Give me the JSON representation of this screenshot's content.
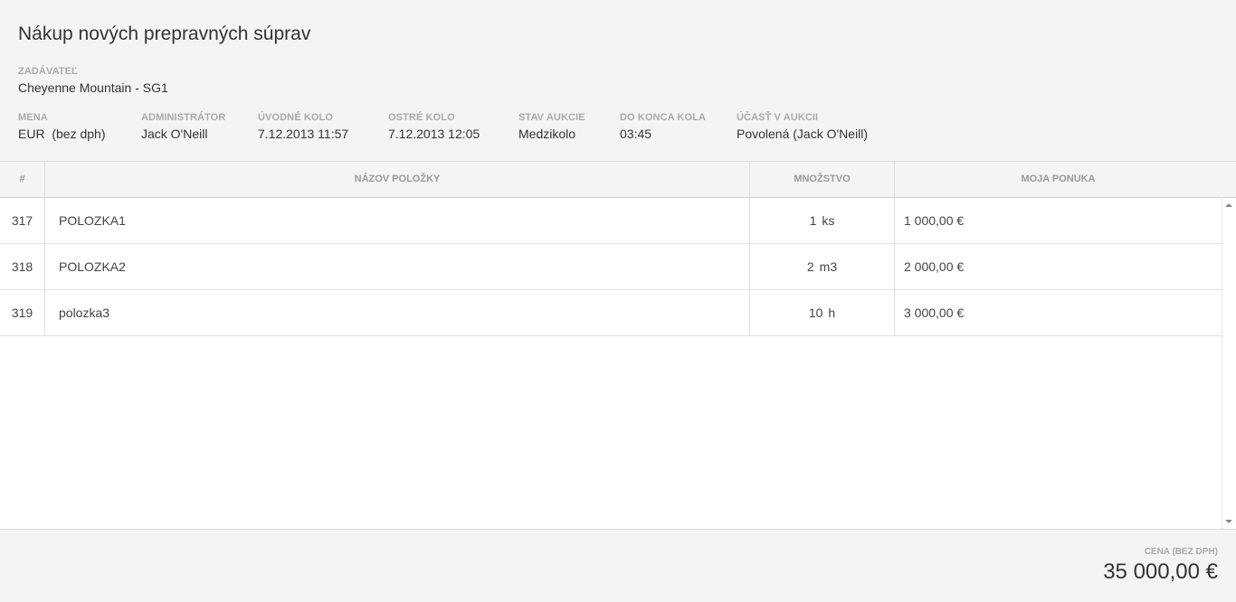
{
  "header": {
    "title": "Nákup nových prepravných súprav",
    "requester": {
      "label": "ZADÁVATEĽ",
      "value": "Cheyenne Mountain - SG1"
    },
    "meta": [
      {
        "label": "MENA",
        "value": "EUR  (bez dph)"
      },
      {
        "label": "ADMINISTRÁTOR",
        "value": "Jack O'Neill"
      },
      {
        "label": "ÚVODNÉ KOLO",
        "value": "7.12.2013 11:57"
      },
      {
        "label": "OSTRÉ KOLO",
        "value": "7.12.2013 12:05"
      },
      {
        "label": "STAV AUKCIE",
        "value": "Medzikolo"
      },
      {
        "label": "DO KONCA KOLA",
        "value": "03:45"
      },
      {
        "label": "ÚČASŤ V AUKCII",
        "value": "Povolená (Jack O'Neill)"
      }
    ]
  },
  "table": {
    "columns": [
      "#",
      "NÁZOV POLOŽKY",
      "MNOŽSTVO",
      "MOJA PONUKA"
    ],
    "rows": [
      {
        "num": "317",
        "name": "POLOZKA1",
        "qty": "1",
        "unit": "ks",
        "price": "1 000,00 €"
      },
      {
        "num": "318",
        "name": "POLOZKA2",
        "qty": "2",
        "unit": "m3",
        "price": "2 000,00 €"
      },
      {
        "num": "319",
        "name": "polozka3",
        "qty": "10",
        "unit": "h",
        "price": "3 000,00 €"
      }
    ]
  },
  "footer": {
    "total_label": "CENA (BEZ DPH)",
    "total_value": "35 000,00 €"
  }
}
